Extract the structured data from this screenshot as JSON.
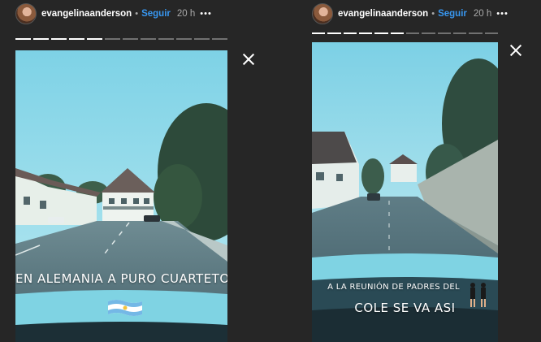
{
  "stories": [
    {
      "username": "evangelinaanderson",
      "separator": "•",
      "follow_label": "Seguir",
      "time": "20 h",
      "more_label": "•••",
      "progress": {
        "segments": 12,
        "done": 5
      },
      "caption": "EN ALEMANIA A PURO CUARTETO",
      "sticker": "argentina-flag-sticker"
    },
    {
      "username": "evangelinaanderson",
      "separator": "•",
      "follow_label": "Seguir",
      "time": "20 h",
      "more_label": "•••",
      "progress": {
        "segments": 12,
        "done": 6
      },
      "caption_line1": "A LA REUNIÓN DE PADRES DEL",
      "caption_line2": "COLE SE VA ASI",
      "sticker": "dancing-figures-sticker"
    }
  ],
  "colors": {
    "background": "#262626",
    "follow": "#3897f0",
    "sky": "#8fd6ea",
    "road": "#5c7a82",
    "dashboard": "#7fd3e3"
  },
  "icons": [
    "close-icon",
    "more-options-icon",
    "avatar"
  ]
}
